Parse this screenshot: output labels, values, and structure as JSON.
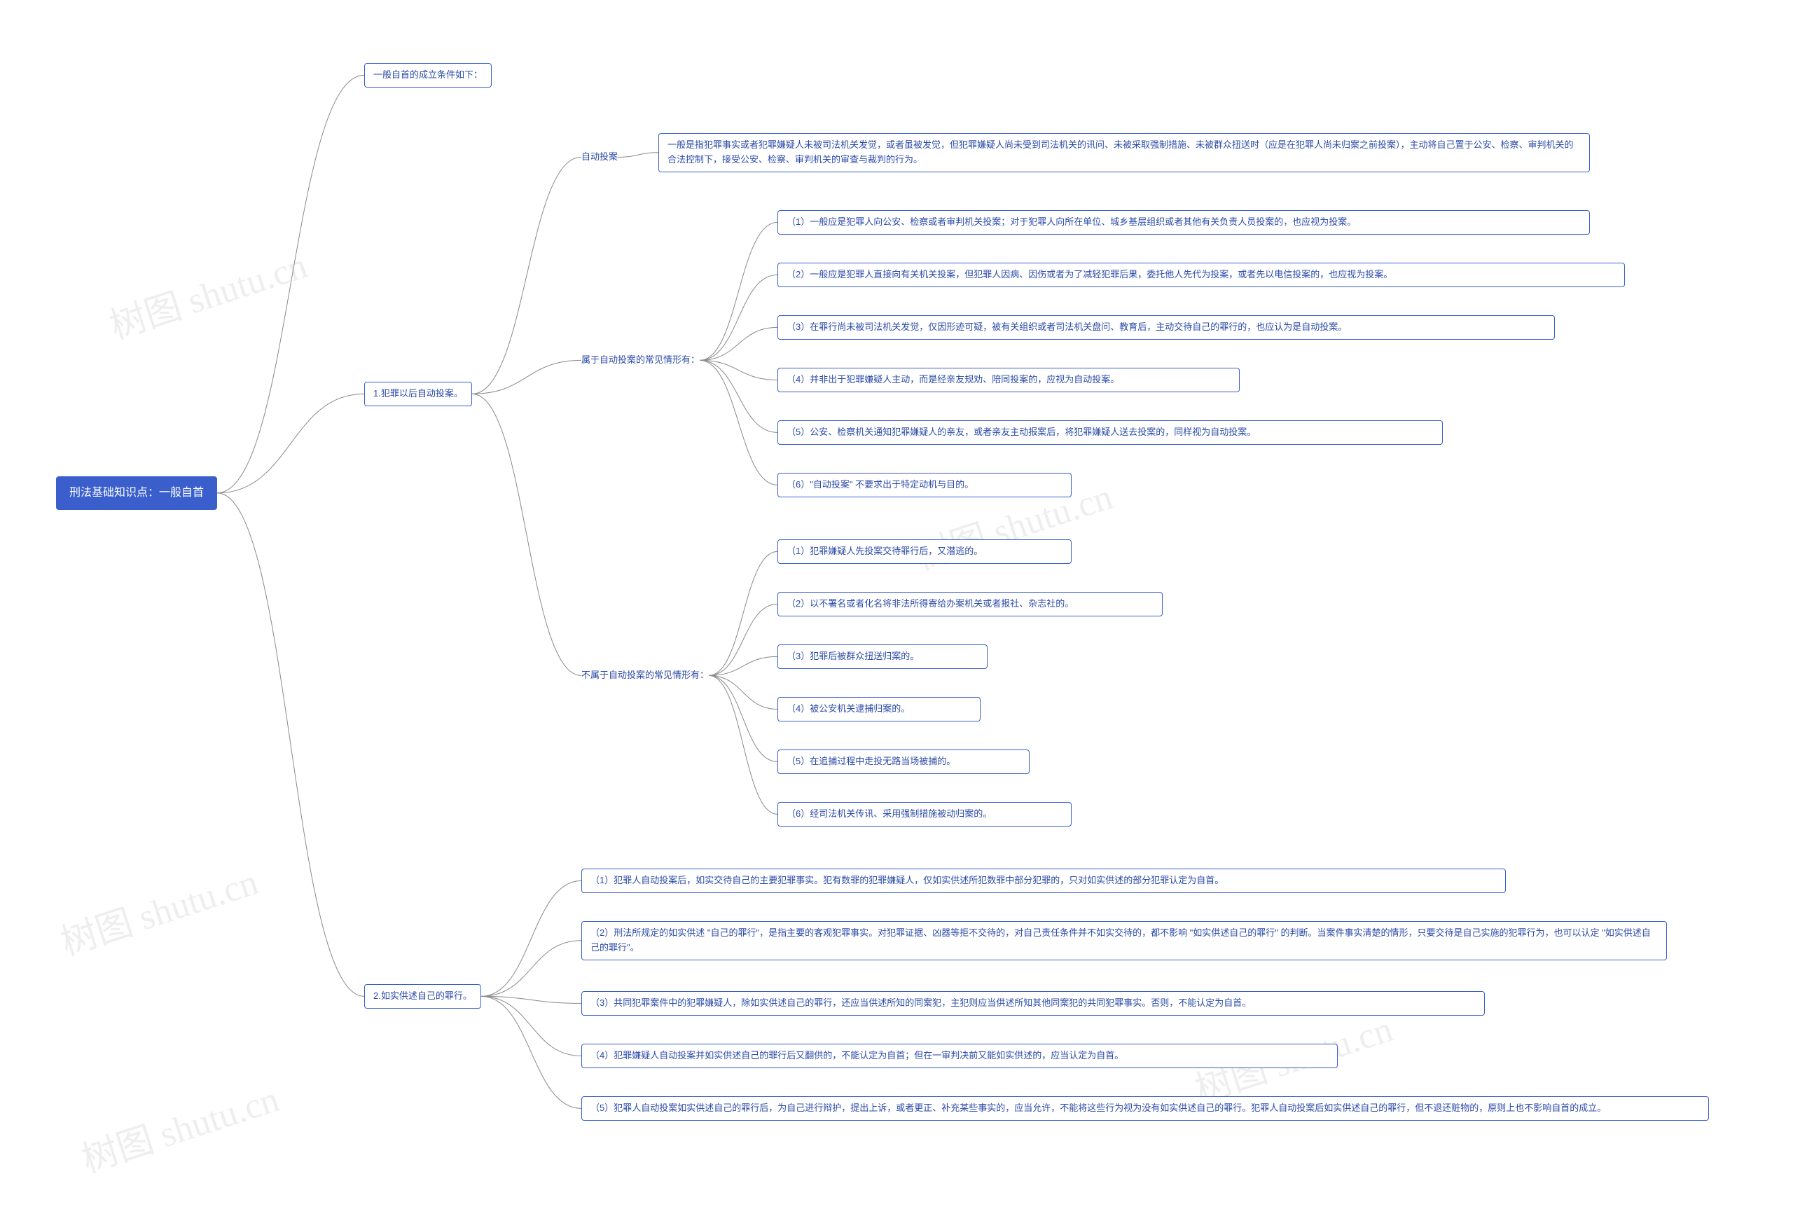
{
  "watermark_text": "树图 shutu.cn",
  "root": {
    "text": "刑法基础知识点：一般自首"
  },
  "b1": {
    "text": "一般自首的成立条件如下："
  },
  "b2": {
    "text": "1.犯罪以后自动投案。"
  },
  "b3": {
    "text": "2.如实供述自己的罪行。"
  },
  "b2a": {
    "label": "自动投案",
    "desc": "一般是指犯罪事实或者犯罪嫌疑人未被司法机关发觉，或者虽被发觉，但犯罪嫌疑人尚未受到司法机关的讯问、未被采取强制措施、未被群众扭送时（应是在犯罪人尚未归案之前投案），主动将自己置于公安、检察、审判机关的合法控制下，接受公安、检察、审判机关的审查与裁判的行为。"
  },
  "b2b": {
    "label": "属于自动投案的常见情形有："
  },
  "b2c": {
    "label": "不属于自动投案的常见情形有："
  },
  "b2b_items": [
    "（1）一般应是犯罪人向公安、检察或者审判机关投案；对于犯罪人向所在单位、城乡基层组织或者其他有关负责人员投案的，也应视为投案。",
    "（2）一般应是犯罪人直接向有关机关投案，但犯罪人因病、因伤或者为了减轻犯罪后果，委托他人先代为投案，或者先以电信投案的，也应视为投案。",
    "（3）在罪行尚未被司法机关发觉，仅因形迹可疑，被有关组织或者司法机关盘问、教育后，主动交待自己的罪行的，也应认为是自动投案。",
    "（4）并非出于犯罪嫌疑人主动，而是经亲友规劝、陪同投案的，应视为自动投案。",
    "（5）公安、检察机关通知犯罪嫌疑人的亲友，或者亲友主动报案后，将犯罪嫌疑人送去投案的，同样视为自动投案。",
    "（6）\"自动投案\" 不要求出于特定动机与目的。"
  ],
  "b2c_items": [
    "（1）犯罪嫌疑人先投案交待罪行后，又潜逃的。",
    "（2）以不署名或者化名将非法所得寄给办案机关或者报社、杂志社的。",
    "（3）犯罪后被群众扭送归案的。",
    "（4）被公安机关逮捕归案的。",
    "（5）在追捕过程中走投无路当场被捕的。",
    "（6）经司法机关传讯、采用强制措施被动归案的。"
  ],
  "b3_items": [
    "（1）犯罪人自动投案后，如实交待自己的主要犯罪事实。犯有数罪的犯罪嫌疑人，仅如实供述所犯数罪中部分犯罪的，只对如实供述的部分犯罪认定为自首。",
    "（2）刑法所规定的如实供述 \"自己的罪行\"，是指主要的客观犯罪事实。对犯罪证据、凶器等拒不交待的，对自己责任条件并不如实交待的，都不影响 \"如实供述自己的罪行\" 的判断。当案件事实清楚的情形，只要交待是自己实施的犯罪行为，也可以认定 \"如实供述自己的罪行\"。",
    "（3）共同犯罪案件中的犯罪嫌疑人，除如实供述自己的罪行，还应当供述所知的同案犯，主犯则应当供述所知其他同案犯的共同犯罪事实。否则，不能认定为自首。",
    "（4）犯罪嫌疑人自动投案并如实供述自己的罪行后又翻供的，不能认定为自首；但在一审判决前又能如实供述的，应当认定为自首。",
    "（5）犯罪人自动投案如实供述自己的罪行后，为自己进行辩护，提出上诉，或者更正、补充某些事实的，应当允许，不能将这些行为视为没有如实供述自己的罪行。犯罪人自动投案后如实供述自己的罪行，但不退还赃物的，原则上也不影响自首的成立。"
  ]
}
